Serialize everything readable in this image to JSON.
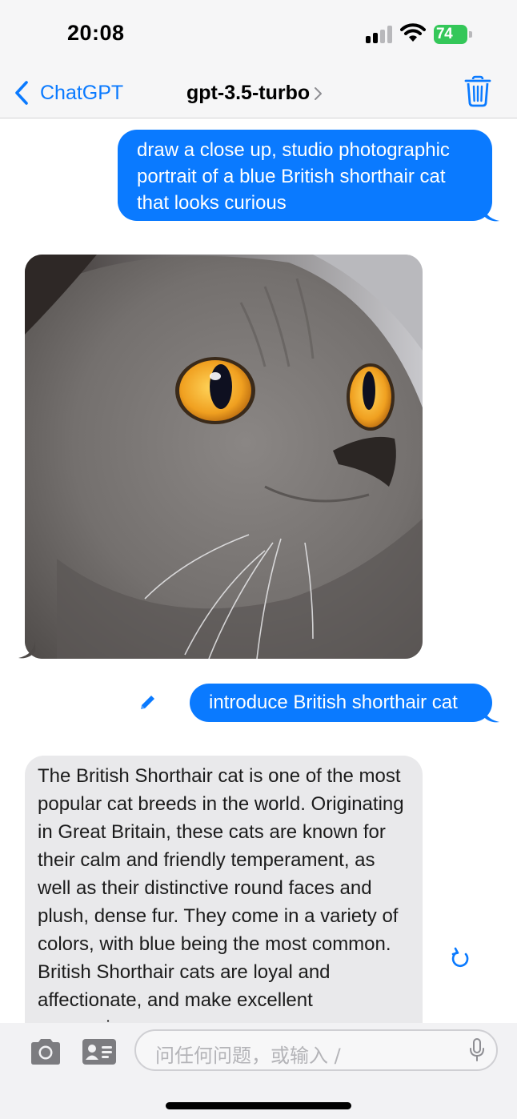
{
  "status_bar": {
    "time": "20:08",
    "battery": "74"
  },
  "nav": {
    "back_label": "ChatGPT",
    "title": "gpt-3.5-turbo"
  },
  "messages": [
    {
      "role": "user",
      "text": "draw a close up, studio photographic portrait of a blue British shorthair cat that looks curious"
    },
    {
      "role": "assistant",
      "type": "image",
      "image_subject": "close-up of a grey British shorthair cat with orange eyes"
    },
    {
      "role": "user",
      "text": "introduce British shorthair cat"
    },
    {
      "role": "assistant",
      "text": "The British Shorthair cat is one of the most popular cat breeds in the world. Originating in Great Britain, these cats are known for their calm and friendly temperament, as well as their distinctive round faces and plush, dense fur. They come in a variety of colors, with blue being the most common. British Shorthair cats are loyal and affectionate, and make excellent companions."
    }
  ],
  "input": {
    "placeholder": "问任何问题，或输入 /"
  },
  "colors": {
    "accent": "#0a7aff",
    "incoming_bubble": "#e9e9eb",
    "battery_green": "#34c759"
  },
  "icons": [
    "back-chevron-icon",
    "title-chevron-icon",
    "trash-icon",
    "edit-pencil-icon",
    "refresh-icon",
    "camera-icon",
    "contact-card-icon",
    "microphone-icon"
  ]
}
